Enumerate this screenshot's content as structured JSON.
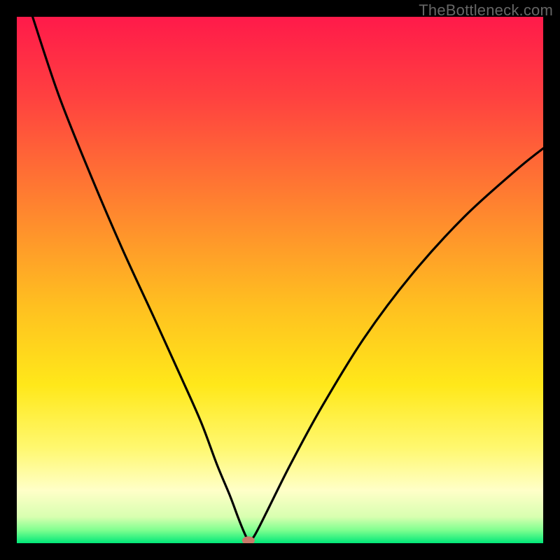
{
  "watermark": "TheBottleneck.com",
  "chart_data": {
    "type": "line",
    "title": "",
    "xlabel": "",
    "ylabel": "",
    "xlim": [
      0,
      100
    ],
    "ylim": [
      0,
      100
    ],
    "gradient_stops": [
      {
        "offset": 0.0,
        "color": "#ff1a4a"
      },
      {
        "offset": 0.15,
        "color": "#ff4040"
      },
      {
        "offset": 0.35,
        "color": "#ff8030"
      },
      {
        "offset": 0.55,
        "color": "#ffc020"
      },
      {
        "offset": 0.7,
        "color": "#ffe81a"
      },
      {
        "offset": 0.82,
        "color": "#fff870"
      },
      {
        "offset": 0.9,
        "color": "#ffffc8"
      },
      {
        "offset": 0.95,
        "color": "#d8ffb0"
      },
      {
        "offset": 0.975,
        "color": "#80ff90"
      },
      {
        "offset": 1.0,
        "color": "#00e878"
      }
    ],
    "series": [
      {
        "name": "bottleneck-curve",
        "x": [
          3,
          8,
          14,
          20,
          26,
          31,
          35,
          38,
          40.5,
          42,
          43,
          43.7,
          44.3,
          45,
          46,
          48,
          52,
          58,
          66,
          75,
          85,
          95,
          100
        ],
        "y": [
          100,
          85,
          70,
          56,
          43,
          32,
          23,
          15,
          9,
          5,
          2.5,
          1,
          0.5,
          1.2,
          3,
          7,
          15,
          26,
          39,
          51,
          62,
          71,
          75
        ]
      }
    ],
    "marker": {
      "x": 44,
      "y": 0.5,
      "color": "#c97a6a",
      "rx": 9,
      "ry": 6
    }
  }
}
